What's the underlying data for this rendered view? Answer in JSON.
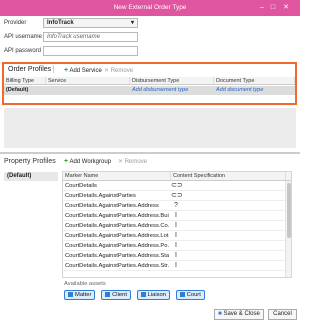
{
  "window": {
    "title": "New External Order Type"
  },
  "form": {
    "provider": {
      "label": "Provider",
      "value": "InfoTrack"
    },
    "api_username": {
      "label": "API username",
      "placeholder": "InfoTrack username"
    },
    "api_password": {
      "label": "API password",
      "value": ""
    }
  },
  "order_profiles": {
    "title": "Order Profiles",
    "add_label": "Add Service",
    "remove_label": "Remove",
    "columns": [
      "Billing Type",
      "Service",
      "Disbursement Type",
      "Document Type"
    ],
    "row": {
      "billing": "(Default)",
      "service": "",
      "disbursement": "Add disbursement type",
      "document": "Add document type"
    }
  },
  "property_profiles": {
    "title": "Property Profiles",
    "default_item": "(Default)",
    "add_label": "Add Workgroup",
    "remove_label": "Remove",
    "columns": [
      "Marker Name",
      "Content Specification"
    ],
    "markers": [
      {
        "name": "CourtDetails",
        "icon": "link-icon"
      },
      {
        "name": "CourtDetails.AgainstParties",
        "icon": "link-icon"
      },
      {
        "name": "CourtDetails.AgainstParties.Address",
        "icon": "question-icon"
      },
      {
        "name": "CourtDetails.AgainstParties.Address.Bui...",
        "icon": "text-cursor-icon"
      },
      {
        "name": "CourtDetails.AgainstParties.Address.Co...",
        "icon": "text-cursor-icon"
      },
      {
        "name": "CourtDetails.AgainstParties.Address.Lot...",
        "icon": "text-cursor-icon"
      },
      {
        "name": "CourtDetails.AgainstParties.Address.Po...",
        "icon": "text-cursor-icon"
      },
      {
        "name": "CourtDetails.AgainstParties.Address.State",
        "icon": "text-cursor-icon"
      },
      {
        "name": "CourtDetails.AgainstParties.Address.Str...",
        "icon": "text-cursor-icon"
      }
    ],
    "assets_label": "Available assets",
    "assets": [
      "Matter",
      "Client",
      "Liaison",
      "Court"
    ]
  },
  "footer": {
    "save_close": "Save & Close",
    "cancel": "Cancel"
  },
  "colors": {
    "titlebar": "#e0559f",
    "highlight_border": "#ef6a2f",
    "link": "#2166c6",
    "add": "#2a9d2a"
  }
}
